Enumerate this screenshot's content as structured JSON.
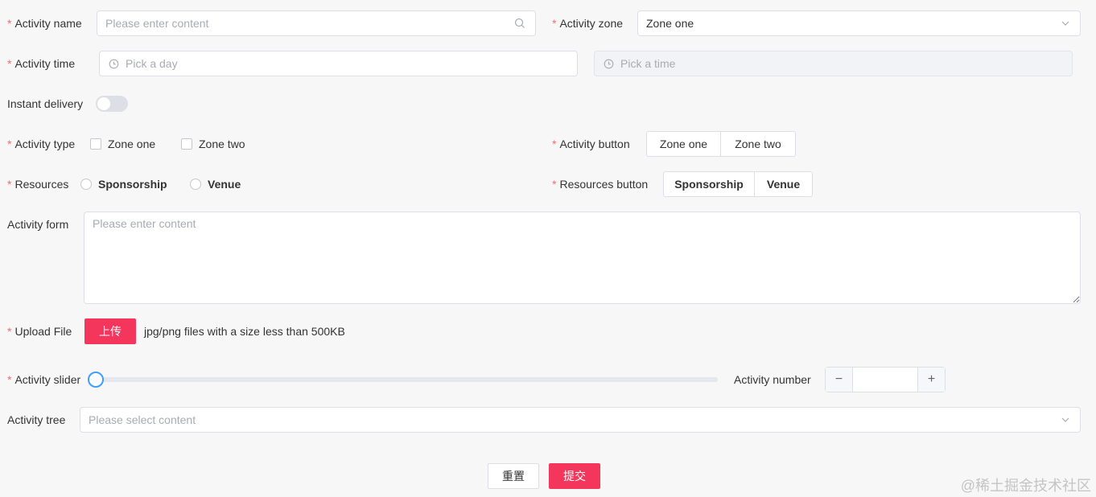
{
  "form": {
    "activity_name": {
      "label": "Activity name",
      "placeholder": "Please enter content"
    },
    "activity_zone": {
      "label": "Activity zone",
      "value": "Zone one"
    },
    "activity_time": {
      "label": "Activity time",
      "date_placeholder": "Pick a day",
      "time_placeholder": "Pick a time"
    },
    "instant_delivery": {
      "label": "Instant delivery",
      "on": false
    },
    "activity_type": {
      "label": "Activity type",
      "options": [
        "Zone one",
        "Zone two"
      ]
    },
    "activity_button": {
      "label": "Activity button",
      "options": [
        "Zone one",
        "Zone two"
      ]
    },
    "resources": {
      "label": "Resources",
      "options": [
        "Sponsorship",
        "Venue"
      ]
    },
    "resources_button": {
      "label": "Resources button",
      "options": [
        "Sponsorship",
        "Venue"
      ]
    },
    "activity_form": {
      "label": "Activity form",
      "placeholder": "Please enter content"
    },
    "upload_file": {
      "label": "Upload File",
      "button": "上传",
      "hint": "jpg/png files with a size less than 500KB"
    },
    "activity_slider": {
      "label": "Activity slider",
      "value": 0
    },
    "activity_number": {
      "label": "Activity number",
      "minus": "−",
      "plus": "+"
    },
    "activity_tree": {
      "label": "Activity tree",
      "placeholder": "Please select content"
    },
    "required_mark": "*"
  },
  "actions": {
    "reset": "重置",
    "submit": "提交"
  },
  "watermark": "@稀土掘金技术社区",
  "colors": {
    "primary_red": "#f5365c",
    "required": "#f56c6c",
    "slider_blue": "#409eff"
  },
  "icons": [
    "search-icon",
    "chevron-down-icon",
    "clock-icon"
  ]
}
